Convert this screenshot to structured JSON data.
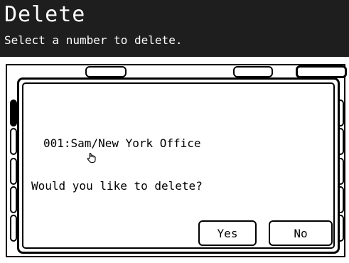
{
  "screen": {
    "title": "Delete",
    "subtitle": "Select a number to delete."
  },
  "dialog": {
    "entry": "001:Sam/New York Office",
    "question": "Would you like to delete?",
    "yes_label": "Yes",
    "no_label": "No",
    "entry_icon": "hand-icon"
  },
  "colors": {
    "header_bg": "#1e1e1e",
    "header_text": "#ffffff",
    "line": "#000000",
    "background": "#ffffff"
  }
}
